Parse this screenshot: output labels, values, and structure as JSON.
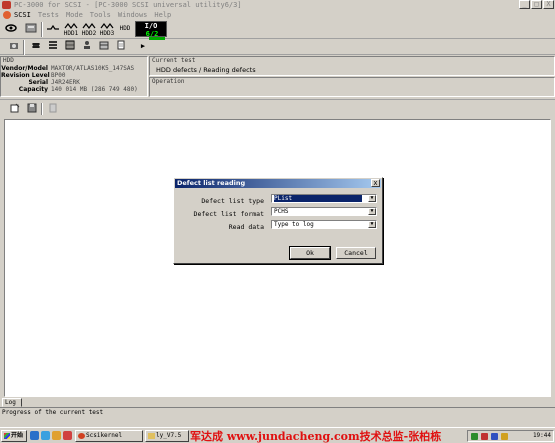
{
  "window": {
    "title": "PC-3000 for SCSI   - [PC-3000 SCSI universal utility6/3]",
    "controls": [
      "_",
      "□",
      "X"
    ]
  },
  "menu": {
    "items": [
      "SCSI",
      "Tests",
      "Mode",
      "Tools",
      "Windows",
      "Help"
    ]
  },
  "toolbar": {
    "hdd1": "HDD1",
    "hdd2": "HDD2",
    "hdd3": "HDD3",
    "hdd": "HDD",
    "io_label": "I/O",
    "io_value": "6/2",
    "more_arrow": "▶"
  },
  "hdd_info": {
    "header": "HDD",
    "rows": [
      {
        "label": "Vendor/Model",
        "value": "MAXTOR/ATLAS10K5_147SAS"
      },
      {
        "label": "Revision Level",
        "value": "BP00"
      },
      {
        "label": "Serial",
        "value": "J4R24ERK"
      },
      {
        "label": "Capacity",
        "value": "140 014 MB (286 749 480)"
      }
    ]
  },
  "current_test": {
    "header": "Current test",
    "value": "HDD defects / Reading defects",
    "operation_header": "Operation",
    "operation_value": ""
  },
  "dialog": {
    "title": "Defect list reading",
    "close": "x",
    "fields": [
      {
        "label": "Defect list type",
        "value": "PList"
      },
      {
        "label": "Defect list format",
        "value": "PCHS"
      },
      {
        "label": "Read data",
        "value": "Type to log"
      }
    ],
    "ok_label": "Ok",
    "cancel_label": "Cancel"
  },
  "log": {
    "tab_label": "Log",
    "status_text": "Progress of the current test"
  },
  "taskbar": {
    "start_label": "开始",
    "tasks": [
      {
        "label": "Scsikernel"
      },
      {
        "label": "ly_V7.5"
      }
    ],
    "watermark": "军达成 www.jundacheng.com技术总监-张柏栋",
    "clock": "19:44"
  },
  "colors": {
    "title_gradient_start": "#0a246a",
    "title_gradient_end": "#a6caf0",
    "selection": "#0a246a",
    "watermark": "#e01010",
    "io_bg": "#000000",
    "io_fg": "#ffffff",
    "io_value_fg": "#00ff00"
  }
}
